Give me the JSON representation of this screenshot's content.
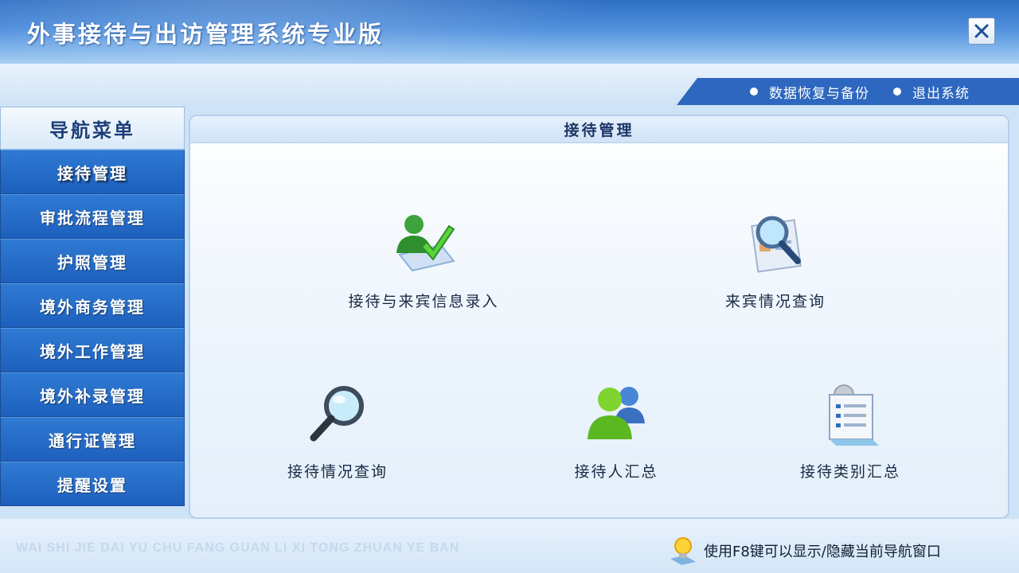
{
  "window": {
    "title": "外事接待与出访管理系统专业版",
    "close_icon": "close-icon"
  },
  "top_links": [
    {
      "label": "数据恢复与备份"
    },
    {
      "label": "退出系统"
    }
  ],
  "nav": {
    "header": "导航菜单",
    "items": [
      {
        "label": "接待管理",
        "active": true
      },
      {
        "label": "审批流程管理"
      },
      {
        "label": "护照管理"
      },
      {
        "label": "境外商务管理"
      },
      {
        "label": "境外工作管理"
      },
      {
        "label": "境外补录管理"
      },
      {
        "label": "通行证管理"
      },
      {
        "label": "提醒设置"
      }
    ]
  },
  "panel": {
    "title": "接待管理",
    "features": [
      {
        "label": "接待与来宾信息录入",
        "icon": "user-check-icon"
      },
      {
        "label": "来宾情况查询",
        "icon": "document-search-icon"
      },
      {
        "label": "接待情况查询",
        "icon": "magnifier-icon"
      },
      {
        "label": "接待人汇总",
        "icon": "users-icon"
      },
      {
        "label": "接待类别汇总",
        "icon": "report-settings-icon"
      }
    ]
  },
  "footer": {
    "pinyin": "WAI SHI JIE DAI YU CHU FANG GUAN LI XI TONG ZHUAN YE BAN",
    "hint": "使用F8键可以显示/隐藏当前导航窗口",
    "hint_icon": "lightbulb-icon"
  },
  "colors": {
    "title_bar": "#3a7ad0",
    "nav_item": "#2468c4",
    "band_blue": "#2d67bf",
    "panel_border": "#b4d0ee"
  }
}
